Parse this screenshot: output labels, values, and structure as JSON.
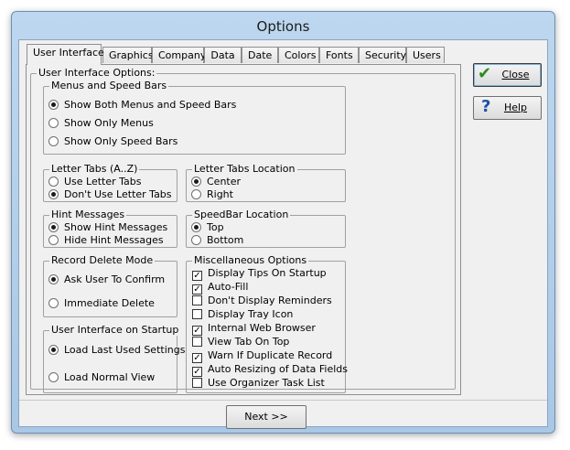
{
  "window": {
    "title": "Options"
  },
  "tabs": [
    "User Interface",
    "Graphics",
    "Company",
    "Data",
    "Date",
    "Colors",
    "Fonts",
    "Security",
    "Users"
  ],
  "page": {
    "group_title": "User Interface Options:",
    "menus": {
      "title": "Menus and Speed Bars",
      "options": [
        "Show Both Menus and Speed Bars",
        "Show Only Menus",
        "Show Only Speed Bars"
      ],
      "selected": 0
    },
    "letter_tabs": {
      "title": "Letter Tabs (A..Z)",
      "options": [
        "Use Letter Tabs",
        "Don't Use Letter Tabs"
      ],
      "selected": 1
    },
    "letter_tabs_location": {
      "title": "Letter Tabs Location",
      "options": [
        "Center",
        "Right"
      ],
      "selected": 0
    },
    "hint_messages": {
      "title": "Hint Messages",
      "options": [
        "Show Hint Messages",
        "Hide Hint Messages"
      ],
      "selected": 0
    },
    "speedbar_location": {
      "title": "SpeedBar Location",
      "options": [
        "Top",
        "Bottom"
      ],
      "selected": 0
    },
    "record_delete": {
      "title": "Record Delete Mode",
      "options": [
        "Ask User To Confirm",
        "Immediate Delete"
      ],
      "selected": 0
    },
    "startup": {
      "title": "User Interface on Startup",
      "options": [
        "Load Last Used Settings",
        "Load Normal View"
      ],
      "selected": 0
    },
    "misc": {
      "title": "Miscellaneous Options",
      "options": [
        {
          "label": "Display Tips On Startup",
          "checked": true
        },
        {
          "label": "Auto-Fill",
          "checked": true
        },
        {
          "label": "Don't Display Reminders",
          "checked": false
        },
        {
          "label": "Display Tray Icon",
          "checked": false
        },
        {
          "label": "Internal Web Browser",
          "checked": true
        },
        {
          "label": "View Tab On Top",
          "checked": false
        },
        {
          "label": "Warn If Duplicate Record",
          "checked": true
        },
        {
          "label": "Auto Resizing of Data Fields",
          "checked": true
        },
        {
          "label": "Use Organizer Task List",
          "checked": false
        }
      ]
    }
  },
  "buttons": {
    "close": "Close",
    "help": "Help",
    "next": "Next >>"
  },
  "icons": {
    "close": "green-checkmark-icon",
    "help": "blue-question-icon"
  },
  "colors": {
    "check_icon": "#2e8b1e",
    "help_icon": "#1f4fa8"
  }
}
